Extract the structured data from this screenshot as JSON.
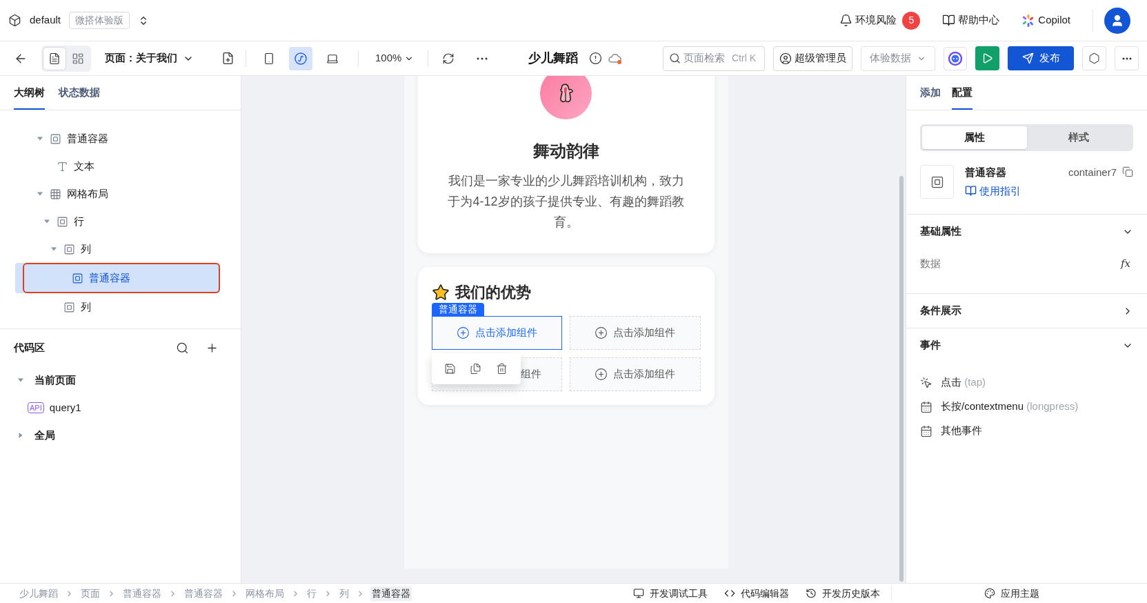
{
  "top_bar": {
    "app_name": "default",
    "edition_badge": "微搭体验版",
    "links": [
      {
        "kind": "alert",
        "label": "环境风险",
        "badge": "5"
      },
      {
        "kind": "help",
        "label": "帮助中心"
      },
      {
        "kind": "copilot",
        "label": "Copilot"
      }
    ]
  },
  "toolbar": {
    "view_toggles": [
      {
        "kind": "outline",
        "selected": true
      },
      {
        "kind": "layout",
        "selected": false
      }
    ],
    "page_selector": "页面：关于我们",
    "devices": [
      {
        "kind": "mobile",
        "selected": false
      },
      {
        "kind": "miniprogram",
        "selected": true
      },
      {
        "kind": "desktop",
        "selected": false
      }
    ],
    "zoom": "100%",
    "app_title": "少儿舞蹈",
    "search": {
      "placeholder": "页面检索",
      "shortcut": "Ctrl K"
    },
    "role": "超级管理员",
    "data_source": "体验数据",
    "publish": "发布"
  },
  "left_panel": {
    "tabs": [
      {
        "label": "大纲树",
        "selected": true
      },
      {
        "label": "状态数据",
        "selected": false
      }
    ],
    "tree": [
      {
        "kind": "container",
        "label": "普通容器",
        "selected": false,
        "expanded": true,
        "children": [
          {
            "kind": "text",
            "label": "文本",
            "selected": false
          }
        ]
      },
      {
        "kind": "grid",
        "label": "网格布局",
        "selected": false,
        "expanded": true,
        "children": [
          {
            "kind": "container",
            "label": "行",
            "selected": false,
            "expanded": true,
            "children": [
              {
                "kind": "container",
                "label": "列",
                "selected": false,
                "expanded": true,
                "children": [
                  {
                    "kind": "container",
                    "label": "普通容器",
                    "selected": true
                  }
                ]
              },
              {
                "kind": "container",
                "label": "列",
                "selected": false
              }
            ]
          }
        ]
      }
    ],
    "code_area": {
      "title": "代码区",
      "groups": [
        {
          "label": "当前页面",
          "expanded": true,
          "children": [
            {
              "badge": "API",
              "label": "query1"
            }
          ]
        },
        {
          "label": "全局",
          "expanded": false
        }
      ]
    }
  },
  "canvas": {
    "intro_card": {
      "title": "舞动韵律",
      "text": "我们是一家专业的少儿舞蹈培训机构，致力于为4-12岁的孩子提供专业、有趣的舞蹈教育。"
    },
    "features_card": {
      "title": "我们的优势",
      "selected_tag": "普通容器",
      "slots": [
        {
          "label": "点击添加组件",
          "selected": true,
          "partly_hidden": false
        },
        {
          "label": "点击添加组件",
          "selected": false,
          "partly_hidden": false
        },
        {
          "label": "组件",
          "selected": false,
          "partly_hidden": true
        },
        {
          "label": "点击添加组件",
          "selected": false,
          "partly_hidden": false
        }
      ]
    }
  },
  "right_panel": {
    "tabs": [
      {
        "label": "添加",
        "selected": false
      },
      {
        "label": "配置",
        "selected": true
      }
    ],
    "segments": [
      {
        "label": "属性",
        "selected": true
      },
      {
        "label": "样式",
        "selected": false
      }
    ],
    "component": {
      "name": "普通容器",
      "id": "container7",
      "guide_link": "使用指引"
    },
    "sections": [
      {
        "kind": "properties",
        "title": "基础属性",
        "expanded": true,
        "fields": [
          {
            "label": "数据",
            "formula": "fx"
          }
        ]
      },
      {
        "title": "条件展示",
        "expanded": false
      },
      {
        "kind": "events",
        "title": "事件",
        "expanded": true,
        "events": [
          {
            "kind": "tap",
            "label": "点击",
            "code": "(tap)"
          },
          {
            "kind": "calendar",
            "label": "长按/contextmenu",
            "code": "(longpress)"
          },
          {
            "kind": "calendar",
            "label": "其他事件"
          }
        ]
      }
    ]
  },
  "status_bar": {
    "breadcrumbs": [
      {
        "label": "少儿舞蹈",
        "selected": false
      },
      {
        "label": "页面",
        "selected": false
      },
      {
        "label": "普通容器",
        "selected": false
      },
      {
        "label": "普通容器",
        "selected": false
      },
      {
        "label": "网格布局",
        "selected": false
      },
      {
        "label": "行",
        "selected": false
      },
      {
        "label": "列",
        "selected": false
      },
      {
        "label": "普通容器",
        "selected": true
      }
    ],
    "tools": [
      {
        "kind": "debug",
        "label": "开发调试工具"
      },
      {
        "kind": "code",
        "label": "代码编辑器"
      },
      {
        "kind": "history",
        "label": "开发历史版本"
      },
      {
        "kind": "theme",
        "label": "应用主题"
      }
    ]
  }
}
